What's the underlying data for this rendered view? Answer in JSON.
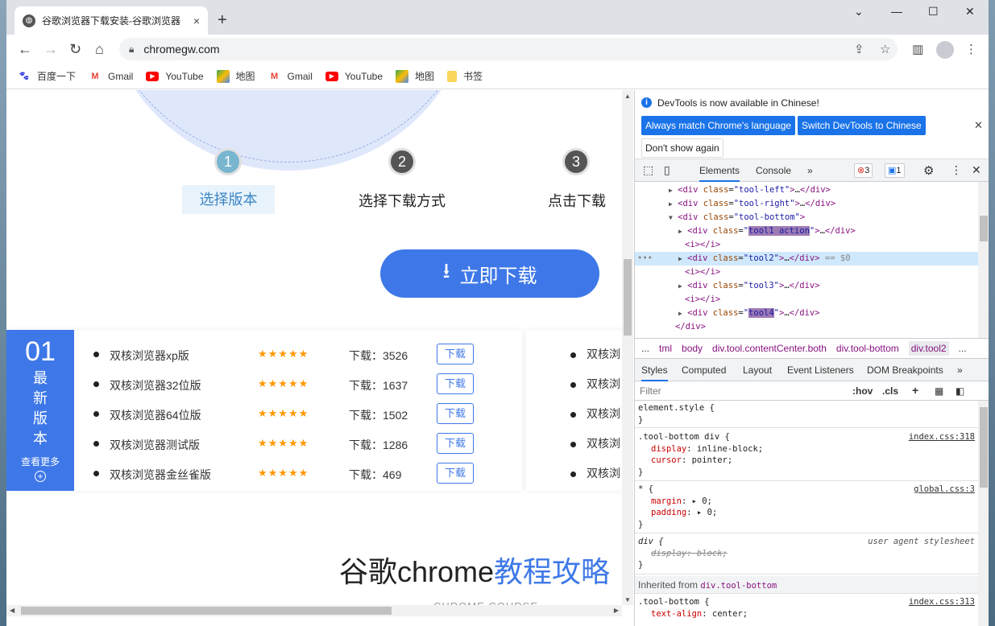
{
  "tab": {
    "title": "谷歌浏览器下载安装-谷歌浏览器",
    "close": "×",
    "new": "+"
  },
  "window_controls": {
    "chevron": "⌄",
    "min": "—",
    "max": "☐",
    "close": "✕"
  },
  "toolbar": {
    "url": "chromegw.com"
  },
  "bookmarks": [
    {
      "label": "百度一下",
      "icon": "baidu-icon",
      "color": "#2932e1"
    },
    {
      "label": "Gmail",
      "icon": "gmail-icon",
      "color": "#ea4335"
    },
    {
      "label": "YouTube",
      "icon": "youtube-icon",
      "color": "#ff0000"
    },
    {
      "label": "地图",
      "icon": "maps-icon",
      "color": "#34a853"
    },
    {
      "label": "Gmail",
      "icon": "gmail-icon",
      "color": "#ea4335"
    },
    {
      "label": "YouTube",
      "icon": "youtube-icon",
      "color": "#ff0000"
    },
    {
      "label": "地图",
      "icon": "maps-icon",
      "color": "#34a853"
    },
    {
      "label": "书签",
      "icon": "folder-icon",
      "color": "#f9d65c"
    }
  ],
  "steps": [
    {
      "num": "1",
      "label": "选择版本",
      "active": true
    },
    {
      "num": "2",
      "label": "选择下载方式",
      "active": false
    },
    {
      "num": "3",
      "label": "点击下载",
      "active": false
    }
  ],
  "download_button": "立即下载",
  "versions_panel": {
    "badge_num": "01",
    "badge_text": [
      "最",
      "新",
      "版",
      "本"
    ],
    "see_more": "查看更多",
    "plus": "+",
    "rows": [
      {
        "name": "双核浏览器xp版",
        "stars": "★★★★★",
        "count": "下载：3526",
        "btn": "下载"
      },
      {
        "name": "双核浏览器32位版",
        "stars": "★★★★★",
        "count": "下载：1637",
        "btn": "下载"
      },
      {
        "name": "双核浏览器64位版",
        "stars": "★★★★★",
        "count": "下载：1502",
        "btn": "下载"
      },
      {
        "name": "双核浏览器测试版",
        "stars": "★★★★★",
        "count": "下载：1286",
        "btn": "下载"
      },
      {
        "name": "双核浏览器金丝雀版",
        "stars": "★★★★★",
        "count": "下载：469",
        "btn": "下载"
      }
    ],
    "second_col": [
      "双核浏",
      "双核浏",
      "双核浏",
      "双核浏",
      "双核浏"
    ]
  },
  "course": {
    "title_a": "谷歌chrome",
    "title_b": "教程攻略",
    "subtitle": "CHROME COURSE"
  },
  "devtools": {
    "notice": "DevTools is now available in Chinese!",
    "btn_match": "Always match Chrome's language",
    "btn_switch": "Switch DevTools to Chinese",
    "btn_dont": "Don't show again",
    "tabs": {
      "elements": "Elements",
      "console": "Console",
      "more": "»"
    },
    "errors": "3",
    "messages": "1",
    "crumbs": [
      "...",
      "tml",
      "body",
      "div.tool.contentCenter.both",
      "div.tool-bottom",
      "div.tool2",
      "..."
    ],
    "sub_tabs": [
      "Styles",
      "Computed",
      "Layout",
      "Event Listeners",
      "DOM Breakpoints",
      "»"
    ],
    "filter": "Filter",
    "hov": ":hov",
    "cls": ".cls",
    "eq": "== $0",
    "dom_sel_marker": "•••",
    "rules": {
      "r0_sel": "element.style {",
      "r1_sel": ".tool-bottom div {",
      "r1_src": "index.css:318",
      "r1_p1": "display",
      "r1_v1": "inline-block;",
      "r1_p2": "cursor",
      "r1_v2": "pointer;",
      "r2_sel": "* {",
      "r2_src": "global.css:3",
      "r2_p1": "margin",
      "r2_v1": "0;",
      "r2_p2": "padding",
      "r2_v2": "0;",
      "r3_sel": "div {",
      "r3_src": "user agent stylesheet",
      "r3_decl": "display: block;",
      "inherited": "Inherited from",
      "inherited_tag": "div.tool-bottom",
      "r4_sel": ".tool-bottom {",
      "r4_src": "index.css:313",
      "r4_p1": "text-align",
      "r4_v1": "center;",
      "close_brace": "}"
    }
  }
}
